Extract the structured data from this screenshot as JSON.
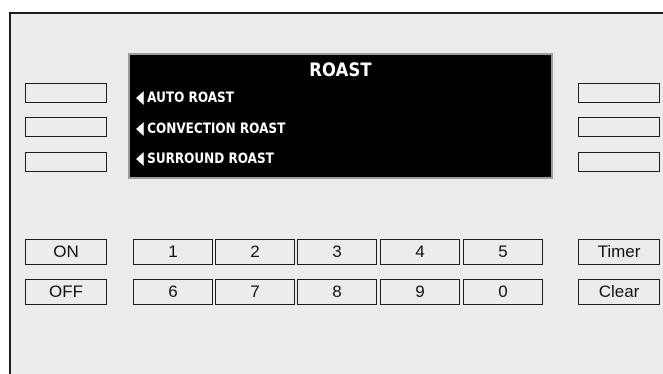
{
  "display": {
    "title": "ROAST",
    "menu": [
      {
        "label": "AUTO ROAST",
        "icon": "left-arrow-icon"
      },
      {
        "label": "CONVECTION ROAST",
        "icon": "left-arrow-icon"
      },
      {
        "label": "SURROUND ROAST",
        "icon": "left-arrow-icon"
      }
    ]
  },
  "keys": {
    "on": "ON",
    "off": "OFF",
    "timer": "Timer",
    "clear": "Clear",
    "numbers_row1": [
      "1",
      "2",
      "3",
      "4",
      "5"
    ],
    "numbers_row2": [
      "6",
      "7",
      "8",
      "9",
      "0"
    ]
  },
  "colors": {
    "panel": "#ececee",
    "display_bg": "#000000",
    "display_text": "#ffffff",
    "outline": "#1d1d1d"
  }
}
